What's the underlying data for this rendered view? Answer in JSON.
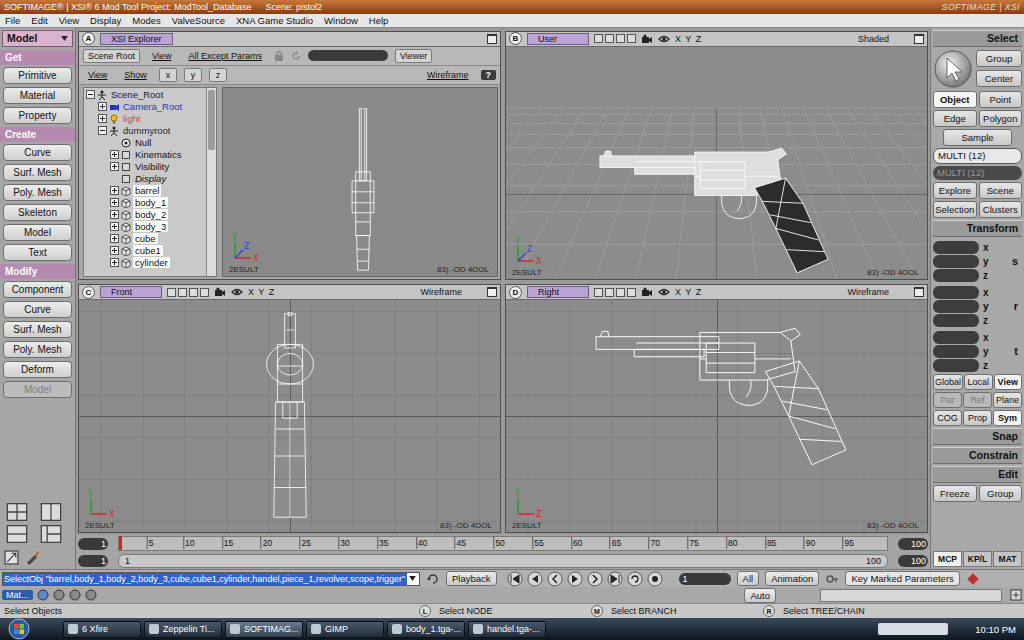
{
  "window": {
    "title": "SOFTIMAGE® | XSI® 6 Mod Tool Project: ModTool_Database",
    "scene": "Scene: pistol2",
    "logo": "SOFTIMAGE | XSI"
  },
  "menu": [
    "File",
    "Edit",
    "View",
    "Display",
    "Modes",
    "ValveSource",
    "XNA Game Studio",
    "Window",
    "Help"
  ],
  "left_panel": {
    "mode": "Model",
    "sections": [
      {
        "title": "Get",
        "buttons": [
          {
            "label": "Primitive",
            "disabled": false
          },
          {
            "label": "Material",
            "disabled": false
          },
          {
            "label": "Property",
            "disabled": false
          }
        ]
      },
      {
        "title": "Create",
        "buttons": [
          {
            "label": "Curve",
            "disabled": false
          },
          {
            "label": "Surf. Mesh",
            "disabled": false
          },
          {
            "label": "Poly. Mesh",
            "disabled": false
          },
          {
            "label": "Skeleton",
            "disabled": false
          },
          {
            "label": "Model",
            "disabled": false
          },
          {
            "label": "Text",
            "disabled": false
          }
        ]
      },
      {
        "title": "Modify",
        "buttons": [
          {
            "label": "Component",
            "disabled": false
          },
          {
            "label": "Curve",
            "disabled": false
          },
          {
            "label": "Surf. Mesh",
            "disabled": false
          },
          {
            "label": "Poly. Mesh",
            "disabled": false
          },
          {
            "label": "Deform",
            "disabled": false
          },
          {
            "label": "Model",
            "disabled": true
          }
        ]
      }
    ]
  },
  "explorer": {
    "letter": "A",
    "view": "XSI Explorer",
    "toolbar": [
      {
        "label": "Scene Root",
        "kind": "button"
      },
      {
        "label": "View",
        "kind": "menu"
      },
      {
        "label": "All Except Params",
        "kind": "menu"
      }
    ],
    "viewer": "Viewer",
    "toolbar2": [
      {
        "label": "View",
        "kind": "menu"
      },
      {
        "label": "Show",
        "kind": "menu"
      },
      {
        "label": "x",
        "kind": "button"
      },
      {
        "label": "y",
        "kind": "button"
      },
      {
        "label": "z",
        "kind": "button"
      }
    ],
    "display_mode": "Wireframe",
    "help": "?",
    "tree": [
      {
        "label": "Scene_Root",
        "depth": 0,
        "kind": "scene",
        "expandable": true,
        "expanded": true,
        "selected": false,
        "italic": false,
        "color": "#1a1a40"
      },
      {
        "label": "Camera_Root",
        "depth": 1,
        "kind": "camera",
        "expandable": true,
        "expanded": false,
        "selected": false,
        "italic": false,
        "color": "#2433c8"
      },
      {
        "label": "light",
        "depth": 1,
        "kind": "light",
        "expandable": true,
        "expanded": false,
        "selected": false,
        "italic": false,
        "color": "#c8501a"
      },
      {
        "label": "dummyroot",
        "depth": 1,
        "kind": "model",
        "expandable": true,
        "expanded": true,
        "selected": false,
        "italic": false,
        "color": "#1a2a2a"
      },
      {
        "label": "Null",
        "depth": 2,
        "kind": "null",
        "expandable": false,
        "expanded": false,
        "selected": false,
        "italic": false,
        "color": "#111111"
      },
      {
        "label": "Kinematics",
        "depth": 2,
        "kind": "property",
        "expandable": true,
        "expanded": false,
        "selected": false,
        "italic": false,
        "color": "#111111"
      },
      {
        "label": "Visibility",
        "depth": 2,
        "kind": "property",
        "expandable": true,
        "expanded": false,
        "selected": false,
        "italic": false,
        "color": "#111111"
      },
      {
        "label": "Display",
        "depth": 2,
        "kind": "property",
        "expandable": false,
        "expanded": false,
        "selected": false,
        "italic": true,
        "color": "#111111"
      },
      {
        "label": "barrel",
        "depth": 2,
        "kind": "mesh",
        "expandable": true,
        "expanded": false,
        "selected": true,
        "italic": false,
        "color": "#111111"
      },
      {
        "label": "body_1",
        "depth": 2,
        "kind": "mesh",
        "expandable": true,
        "expanded": false,
        "selected": true,
        "italic": false,
        "color": "#111111"
      },
      {
        "label": "body_2",
        "depth": 2,
        "kind": "mesh",
        "expandable": true,
        "expanded": false,
        "selected": true,
        "italic": false,
        "color": "#111111"
      },
      {
        "label": "body_3",
        "depth": 2,
        "kind": "mesh",
        "expandable": true,
        "expanded": false,
        "selected": true,
        "italic": false,
        "color": "#111111"
      },
      {
        "label": "cube",
        "depth": 2,
        "kind": "mesh",
        "expandable": true,
        "expanded": false,
        "selected": true,
        "italic": false,
        "color": "#111111"
      },
      {
        "label": "cube1",
        "depth": 2,
        "kind": "mesh",
        "expandable": true,
        "expanded": false,
        "selected": true,
        "italic": false,
        "color": "#111111"
      },
      {
        "label": "cylinder",
        "depth": 2,
        "kind": "mesh",
        "expandable": true,
        "expanded": false,
        "selected": true,
        "italic": false,
        "color": "#111111"
      }
    ],
    "preview": {
      "gizmo": [
        {
          "axis": "Y",
          "kind": "up"
        },
        {
          "axis": "X",
          "kind": "right"
        },
        {
          "axis": "Z",
          "kind": "depth"
        }
      ],
      "footer_left": "2ESULT",
      "footer_right": "83) -OD 4OOL"
    }
  },
  "viewports": [
    {
      "letter": "B",
      "view": "User",
      "axes": "X Y Z",
      "mode": "Shaded",
      "shaded": true,
      "kind": "perspective",
      "gizmo": [
        {
          "axis": "Y",
          "kind": "up"
        },
        {
          "axis": "X",
          "kind": "right"
        },
        {
          "axis": "Z",
          "kind": "depth"
        }
      ],
      "footer_left": "2ESULT",
      "footer_right": "83) -OD 4OOL"
    },
    {
      "letter": "C",
      "view": "Front",
      "axes": "X Y Z",
      "mode": "Wireframe",
      "shaded": false,
      "kind": "front",
      "gizmo": [
        {
          "axis": "Y",
          "kind": "up"
        },
        {
          "axis": "X",
          "kind": "right"
        }
      ],
      "footer_left": "2ESULT",
      "footer_right": "83) -OD 4OOL"
    },
    {
      "letter": "D",
      "view": "Right",
      "axes": "X Y Z",
      "mode": "Wireframe",
      "shaded": false,
      "kind": "side",
      "gizmo": [
        {
          "axis": "Y",
          "kind": "up"
        },
        {
          "axis": "Z",
          "kind": "right"
        }
      ],
      "footer_left": "2ESULT",
      "footer_right": "83) -OD 4OOL"
    }
  ],
  "right_panel": {
    "header": "Select",
    "top_buttons": [
      "Group",
      "Center"
    ],
    "filters": [
      {
        "label": "Object",
        "selected": true
      },
      {
        "label": "Point",
        "selected": false
      },
      {
        "label": "Edge",
        "selected": false
      },
      {
        "label": "Polygon",
        "selected": false
      }
    ],
    "sample": "Sample",
    "multi": [
      {
        "label": "MULTI (12)",
        "active": true
      },
      {
        "label": "MULTI (12)",
        "active": false
      }
    ],
    "nav": [
      "Explore",
      "Scene",
      "Selection",
      "Clusters"
    ],
    "transform": {
      "title": "Transform",
      "groups": [
        {
          "label": "s",
          "fields": [
            "x",
            "y",
            "z"
          ]
        },
        {
          "label": "r",
          "fields": [
            "x",
            "y",
            "z"
          ]
        },
        {
          "label": "t",
          "fields": [
            "x",
            "y",
            "z"
          ]
        }
      ]
    },
    "space": [
      {
        "label": "Global",
        "selected": false,
        "disabled": false
      },
      {
        "label": "Local",
        "selected": false,
        "disabled": false
      },
      {
        "label": "View",
        "selected": true,
        "disabled": false
      }
    ],
    "ref": [
      {
        "label": "Par",
        "selected": false,
        "disabled": true
      },
      {
        "label": "Ref",
        "selected": false,
        "disabled": true
      },
      {
        "label": "Plane",
        "selected": false,
        "disabled": false
      }
    ],
    "options": [
      {
        "label": "COG",
        "selected": false,
        "disabled": false
      },
      {
        "label": "Prop",
        "selected": false,
        "disabled": false
      },
      {
        "label": "Sym",
        "selected": true,
        "disabled": false
      }
    ],
    "sections": [
      "Snap",
      "Constrain",
      "Edit"
    ],
    "edit_buttons": [
      "Freeze",
      "Group"
    ],
    "tabs": [
      {
        "label": "MCP",
        "selected": true
      },
      {
        "label": "KP/L",
        "selected": false
      },
      {
        "label": "MAT",
        "selected": false
      }
    ]
  },
  "timeline": {
    "start": "1",
    "start2": "1",
    "range_start": "1",
    "range_end": "100",
    "end": "100",
    "end2": "100",
    "ticks": [
      "5",
      "10",
      "15",
      "20",
      "25",
      "30",
      "35",
      "40",
      "45",
      "50",
      "55",
      "60",
      "65",
      "70",
      "75",
      "80",
      "85",
      "90",
      "95"
    ],
    "playhead": 0
  },
  "command": {
    "script": "SelectObj \"barrel,body_1,body_2,body_3,cube,cube1,cylinder,handel,piece_1,revolver,scope,trigger\"",
    "playback": "Playback",
    "frame": "1",
    "all": "All",
    "animation": "Animation",
    "auto": "Auto",
    "key": "Key Marked Parameters"
  },
  "status": {
    "tab": "Mat...",
    "message": "Select Objects",
    "mouse": [
      {
        "key": "L",
        "label": "Select NODE"
      },
      {
        "key": "M",
        "label": "Select BRANCH"
      },
      {
        "key": "R",
        "label": "Select TREE/CHAIN"
      }
    ]
  },
  "taskbar": {
    "tasks": [
      {
        "label": "6 Xfire",
        "selected": false
      },
      {
        "label": "Zeppelin Ti...",
        "selected": false
      },
      {
        "label": "SOFTIMAG...",
        "selected": true
      },
      {
        "label": "GIMP",
        "selected": false
      },
      {
        "label": "body_1.tga-...",
        "selected": false
      },
      {
        "label": "handel.tga-...",
        "selected": false
      }
    ],
    "clock": "10:10 PM"
  }
}
